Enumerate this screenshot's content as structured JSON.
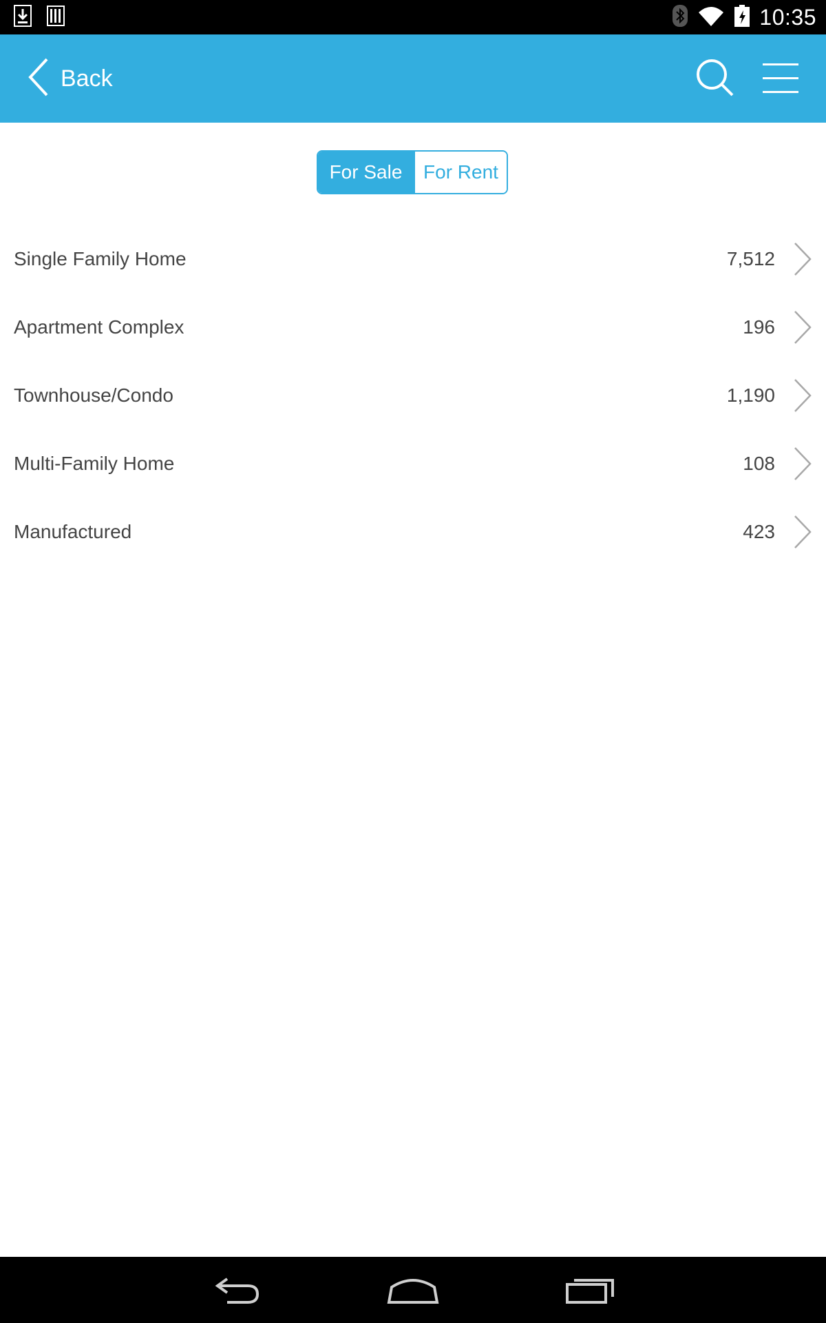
{
  "status_bar": {
    "time": "10:35",
    "icons": [
      "download-icon",
      "barcode-icon",
      "bluetooth-icon",
      "wifi-icon",
      "battery-charging-icon"
    ]
  },
  "header": {
    "back_label": "Back",
    "icons": [
      "back-chevron-icon",
      "search-icon",
      "hamburger-menu-icon"
    ],
    "color": "#33aedf"
  },
  "segmented": {
    "options": [
      {
        "label": "For Sale",
        "selected": true
      },
      {
        "label": "For Rent",
        "selected": false
      }
    ]
  },
  "property_types": [
    {
      "label": "Single Family Home",
      "count": "7,512"
    },
    {
      "label": "Apartment Complex",
      "count": "196"
    },
    {
      "label": "Townhouse/Condo",
      "count": "1,190"
    },
    {
      "label": "Multi-Family Home",
      "count": "108"
    },
    {
      "label": "Manufactured",
      "count": "423"
    }
  ],
  "nav_bar": {
    "icons": [
      "back-nav-icon",
      "home-nav-icon",
      "recents-nav-icon"
    ]
  }
}
